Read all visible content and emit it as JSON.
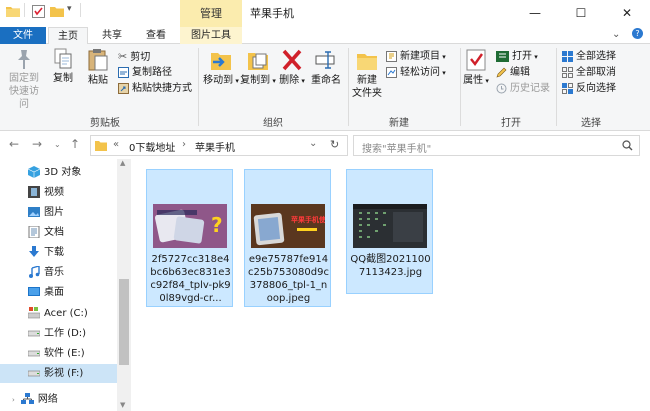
{
  "titlebar": {
    "manage_label": "管理",
    "title": "苹果手机",
    "minimize": "—",
    "maximize": "☐",
    "close": "✕"
  },
  "tabs": {
    "file": "文件",
    "home": "主页",
    "share": "共享",
    "view": "查看",
    "picture_tools": "图片工具"
  },
  "ribbon": {
    "clipboard": {
      "label": "剪贴板",
      "pin_label_1": "固定到",
      "pin_label_2": "快速访问",
      "copy": "复制",
      "paste": "粘贴",
      "cut": "剪切",
      "copy_path": "复制路径",
      "paste_shortcut": "粘贴快捷方式"
    },
    "organize": {
      "label": "组织",
      "move_to": "移动到",
      "copy_to": "复制到",
      "delete": "删除",
      "rename": "重命名"
    },
    "new": {
      "label": "新建",
      "new_folder_1": "新建",
      "new_folder_2": "文件夹",
      "new_item": "新建项目",
      "easy_access": "轻松访问"
    },
    "open": {
      "label": "打开",
      "properties": "属性",
      "open": "打开",
      "edit": "编辑",
      "history": "历史记录"
    },
    "select": {
      "label": "选择",
      "select_all": "全部选择",
      "select_none": "全部取消",
      "invert": "反向选择"
    }
  },
  "address": {
    "prefix": "«",
    "crumb1": "0下载地址",
    "arrow": "›",
    "crumb2": "苹果手机"
  },
  "search": {
    "placeholder": "搜索\"苹果手机\""
  },
  "sidebar": {
    "items": [
      {
        "label": "3D 对象"
      },
      {
        "label": "视频"
      },
      {
        "label": "图片"
      },
      {
        "label": "文档"
      },
      {
        "label": "下载"
      },
      {
        "label": "音乐"
      },
      {
        "label": "桌面"
      },
      {
        "label": "Acer (C:)"
      },
      {
        "label": "工作 (D:)"
      },
      {
        "label": "软件 (E:)"
      },
      {
        "label": "影视 (F:)"
      },
      {
        "label": "网络"
      }
    ]
  },
  "files": [
    {
      "name": "2f5727cc318e4bc6b63ec831e3c92f84_tplv-pk90l89vgd-cr..."
    },
    {
      "name": "e9e75787fe914c25b753080d9c378806_tpl-1_noop.jpeg",
      "thumb_text": "苹果手机使用技巧"
    },
    {
      "name": "QQ截图20211007113423.jpg"
    }
  ],
  "colors": {
    "file_tab": "#1a6fc1",
    "manage_tab": "#fbecae",
    "selection": "#cce8ff",
    "selection_border": "#99d1ff"
  }
}
